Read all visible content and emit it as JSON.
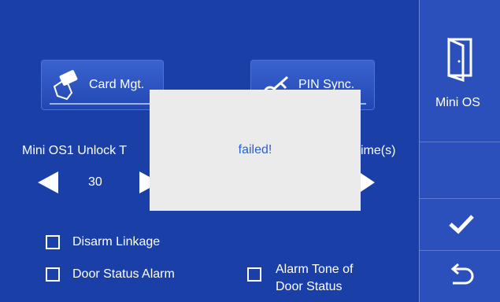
{
  "buttons": {
    "card_mgt": "Card Mgt.",
    "pin_sync": "PIN Sync."
  },
  "settings": {
    "unlock_label_left": "Mini OS1 Unlock T",
    "unlock_label_right": "ime(s)",
    "unlock_value": "30"
  },
  "options": {
    "disarm_linkage": "Disarm Linkage",
    "door_status_alarm": "Door Status Alarm",
    "alarm_tone_line1": "Alarm Tone of",
    "alarm_tone_line2": "Door Status"
  },
  "dialog": {
    "message": "failed!"
  },
  "sidebar": {
    "mini_os_label": "Mini OS"
  },
  "colors": {
    "background": "#1a3fa6",
    "sidebar": "#2b50bc",
    "dialog": "#ebebeb",
    "dialog_text": "#2c62cc"
  },
  "icons": [
    "card-icon",
    "pin-icon",
    "left-arrow-icon",
    "right-arrow-icon",
    "door-icon",
    "check-icon",
    "return-icon"
  ]
}
